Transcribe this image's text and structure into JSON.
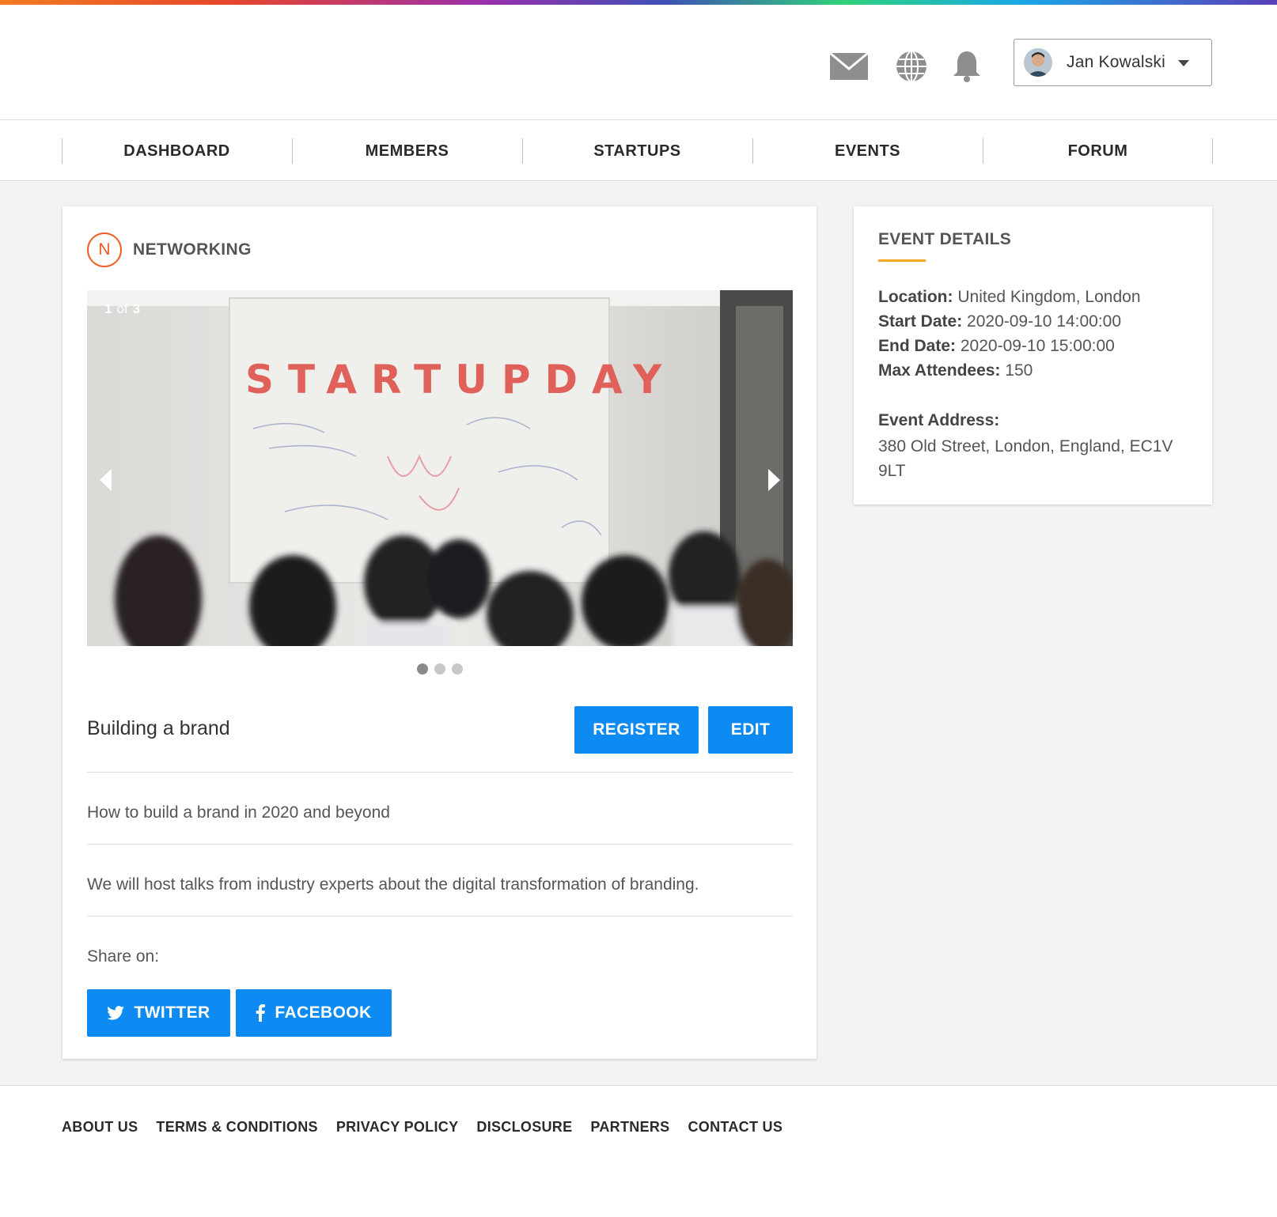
{
  "header": {
    "user_name": "Jan Kowalski",
    "icons": [
      "mail-icon",
      "globe-icon",
      "bell-icon"
    ]
  },
  "nav": {
    "items": [
      {
        "label": "DASHBOARD"
      },
      {
        "label": "MEMBERS"
      },
      {
        "label": "STARTUPS"
      },
      {
        "label": "EVENTS"
      },
      {
        "label": "FORUM"
      }
    ]
  },
  "event": {
    "category_initial": "N",
    "category": "NETWORKING",
    "carousel": {
      "current": "1",
      "of": "of",
      "total": "3",
      "slide_image": "startup-day-whiteboard-photo",
      "banner_text": "STARTUPDAY"
    },
    "title": "Building a brand",
    "register_label": "REGISTER",
    "edit_label": "EDIT",
    "subtitle": "How to build a brand in 2020 and beyond",
    "description": "We will host talks from industry experts about the digital transformation of branding.",
    "share_label": "Share on:",
    "twitter_label": "TWITTER",
    "facebook_label": "FACEBOOK"
  },
  "details": {
    "title": "EVENT DETAILS",
    "location_label": "Location:",
    "location": "United Kingdom, London",
    "start_label": "Start Date:",
    "start": "2020-09-10 14:00:00",
    "end_label": "End Date:",
    "end": "2020-09-10 15:00:00",
    "max_label": "Max Attendees:",
    "max": "150",
    "address_label": "Event Address:",
    "address": "380 Old Street, London, England, EC1V 9LT"
  },
  "footer": {
    "links": [
      "ABOUT US",
      "TERMS & CONDITIONS",
      "PRIVACY POLICY",
      "DISCLOSURE",
      "PARTNERS",
      "CONTACT US"
    ]
  },
  "colors": {
    "primary": "#0d8bf2",
    "category": "#f15a22",
    "underline": "#f5a623",
    "background": "#f3f3f3"
  }
}
